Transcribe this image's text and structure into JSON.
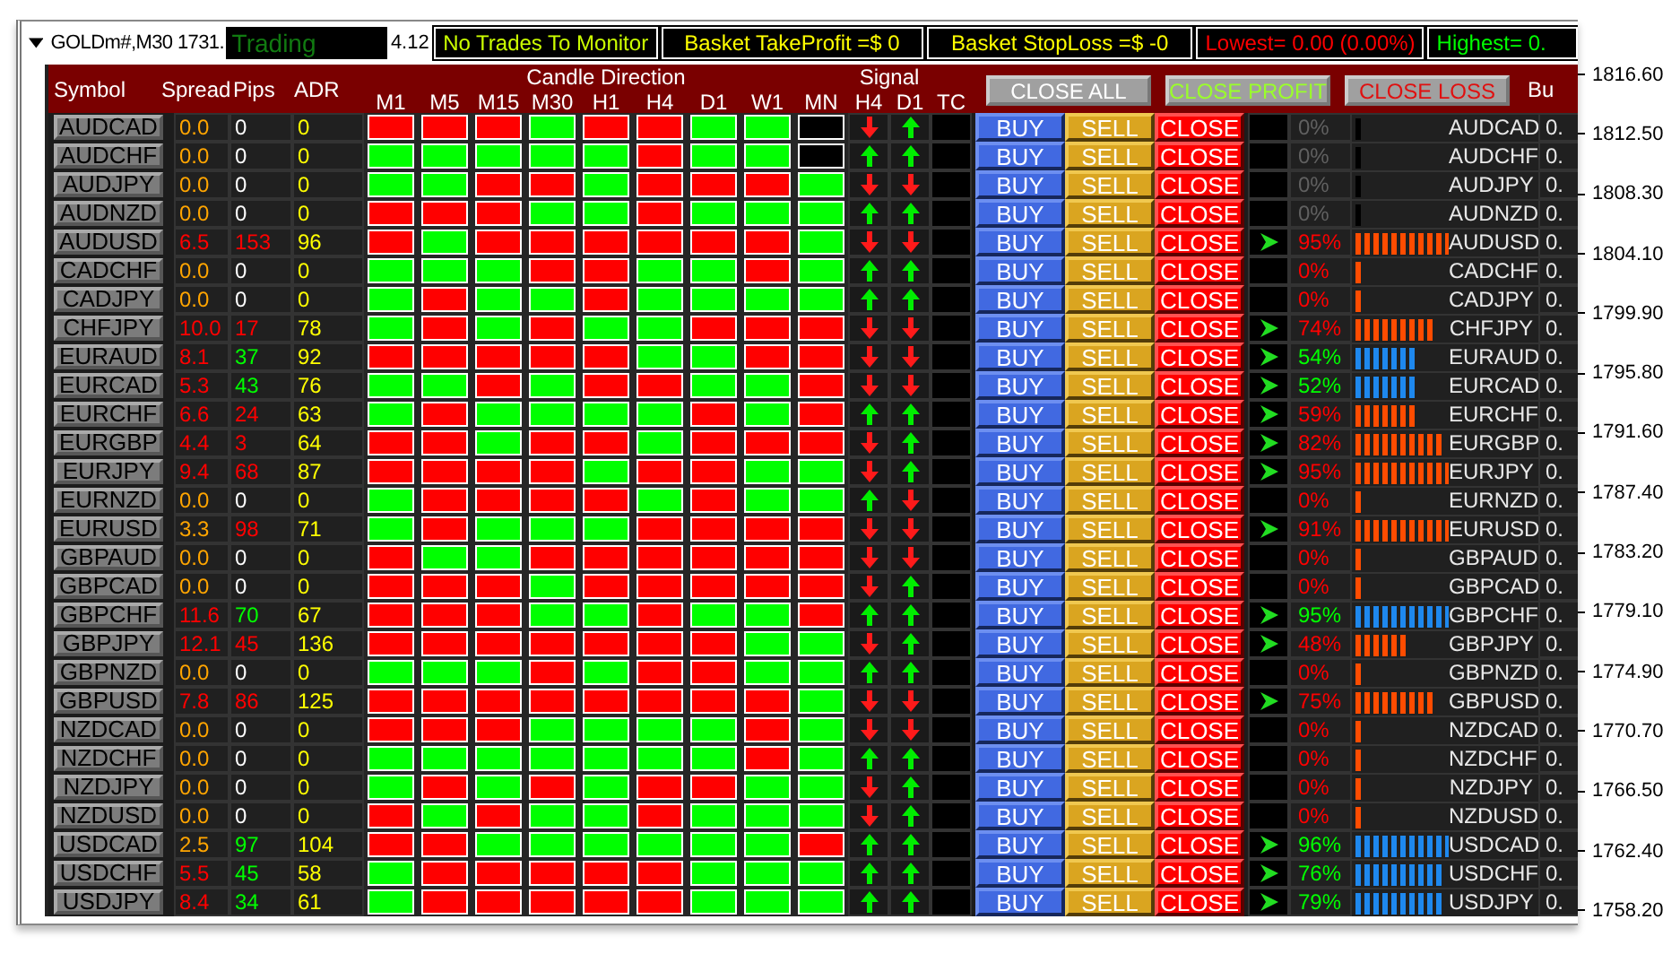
{
  "top_bar": {
    "chart_label": "GOLDm#,M30 1731.",
    "status": "Trading",
    "price_tail": "4.12",
    "panels": [
      {
        "text": "No Trades To Monitor",
        "color": "#ccff00"
      },
      {
        "text": "Basket TakeProfit =$ 0",
        "color": "#ffff00"
      },
      {
        "text": "Basket StopLoss =$ -0",
        "color": "#ffff00"
      },
      {
        "text": "Lowest= 0.00 (0.00%)",
        "color": "#ff0000"
      },
      {
        "text": "Highest= 0.",
        "color": "#00ff00"
      }
    ]
  },
  "header": {
    "symbol": "Symbol",
    "spread": "Spread",
    "pips": "Pips",
    "adr": "ADR",
    "candle_direction": "Candle Direction",
    "timeframes": [
      "M1",
      "M5",
      "M15",
      "M30",
      "H1",
      "H4",
      "D1",
      "W1",
      "MN"
    ],
    "signal": "Signal",
    "signal_columns": [
      "H4",
      "D1"
    ],
    "tc": "TC",
    "buttons": [
      {
        "label": "CLOSE ALL",
        "kind": "all"
      },
      {
        "label": "CLOSE PROFIT",
        "kind": "profit"
      },
      {
        "label": "CLOSE LOSS",
        "kind": "loss"
      }
    ],
    "column_tail": "Bu"
  },
  "rows": [
    {
      "symbol": "AUDCAD",
      "spread": {
        "text": "0.0",
        "color": "#ffa500"
      },
      "pips": {
        "text": "0",
        "color": "#ffffff"
      },
      "adr": "0",
      "candles": [
        {
          "color": "#ff0000"
        },
        {
          "color": "#ff0000"
        },
        {
          "color": "#ff0000"
        },
        {
          "color": "#00ff00"
        },
        {
          "color": "#ff0000"
        },
        {
          "color": "#ff0000"
        },
        {
          "color": "#00ff00"
        },
        {
          "color": "#00ff00"
        },
        {
          "color": "#000000"
        }
      ],
      "h4_up": false,
      "d1_up": true,
      "buy": "BUY",
      "sell": "SELL",
      "close": "CLOSE",
      "trend_arrow": false,
      "strength": {
        "text": "0%",
        "color": "#606060"
      },
      "meter": {
        "color": "#000000"
      },
      "pair": "AUDCAD",
      "value": "0."
    },
    {
      "symbol": "AUDCHF",
      "spread": {
        "text": "0.0",
        "color": "#ffa500"
      },
      "pips": {
        "text": "0",
        "color": "#ffffff"
      },
      "adr": "0",
      "candles": [
        {
          "color": "#00ff00"
        },
        {
          "color": "#00ff00"
        },
        {
          "color": "#00ff00"
        },
        {
          "color": "#00ff00"
        },
        {
          "color": "#00ff00"
        },
        {
          "color": "#ff0000"
        },
        {
          "color": "#00ff00"
        },
        {
          "color": "#00ff00"
        },
        {
          "color": "#000000"
        }
      ],
      "h4_up": true,
      "d1_up": true,
      "buy": "BUY",
      "sell": "SELL",
      "close": "CLOSE",
      "trend_arrow": false,
      "strength": {
        "text": "0%",
        "color": "#606060"
      },
      "meter": {
        "color": "#000000"
      },
      "pair": "AUDCHF",
      "value": "0."
    },
    {
      "symbol": "AUDJPY",
      "spread": {
        "text": "0.0",
        "color": "#ffa500"
      },
      "pips": {
        "text": "0",
        "color": "#ffffff"
      },
      "adr": "0",
      "candles": [
        {
          "color": "#00ff00"
        },
        {
          "color": "#00ff00"
        },
        {
          "color": "#ff0000"
        },
        {
          "color": "#ff0000"
        },
        {
          "color": "#00ff00"
        },
        {
          "color": "#ff0000"
        },
        {
          "color": "#ff0000"
        },
        {
          "color": "#ff0000"
        },
        {
          "color": "#00ff00"
        }
      ],
      "h4_up": false,
      "d1_up": false,
      "buy": "BUY",
      "sell": "SELL",
      "close": "CLOSE",
      "trend_arrow": false,
      "strength": {
        "text": "0%",
        "color": "#606060"
      },
      "meter": {
        "color": "#000000"
      },
      "pair": "AUDJPY",
      "value": "0."
    },
    {
      "symbol": "AUDNZD",
      "spread": {
        "text": "0.0",
        "color": "#ffa500"
      },
      "pips": {
        "text": "0",
        "color": "#ffffff"
      },
      "adr": "0",
      "candles": [
        {
          "color": "#ff0000"
        },
        {
          "color": "#ff0000"
        },
        {
          "color": "#ff0000"
        },
        {
          "color": "#00ff00"
        },
        {
          "color": "#00ff00"
        },
        {
          "color": "#ff0000"
        },
        {
          "color": "#00ff00"
        },
        {
          "color": "#00ff00"
        },
        {
          "color": "#00ff00"
        }
      ],
      "h4_up": true,
      "d1_up": true,
      "buy": "BUY",
      "sell": "SELL",
      "close": "CLOSE",
      "trend_arrow": false,
      "strength": {
        "text": "0%",
        "color": "#606060"
      },
      "meter": {
        "color": "#000000"
      },
      "pair": "AUDNZD",
      "value": "0."
    },
    {
      "symbol": "AUDUSD",
      "spread": {
        "text": "6.5",
        "color": "#ff0000"
      },
      "pips": {
        "text": "153",
        "color": "#ff0000"
      },
      "adr": "96",
      "candles": [
        {
          "color": "#ff0000"
        },
        {
          "color": "#00ff00"
        },
        {
          "color": "#ff0000"
        },
        {
          "color": "#ff0000"
        },
        {
          "color": "#ff0000"
        },
        {
          "color": "#ff0000"
        },
        {
          "color": "#ff0000"
        },
        {
          "color": "#ff0000"
        },
        {
          "color": "#00ff00"
        }
      ],
      "h4_up": false,
      "d1_up": false,
      "buy": "BUY",
      "sell": "SELL",
      "close": "CLOSE",
      "trend_arrow": true,
      "strength": {
        "text": "95%",
        "color": "#ff0000"
      },
      "meter": {
        "color": "#ff4c00"
      },
      "pair": "AUDUSD",
      "value": "0."
    },
    {
      "symbol": "CADCHF",
      "spread": {
        "text": "0.0",
        "color": "#ffa500"
      },
      "pips": {
        "text": "0",
        "color": "#ffffff"
      },
      "adr": "0",
      "candles": [
        {
          "color": "#00ff00"
        },
        {
          "color": "#00ff00"
        },
        {
          "color": "#00ff00"
        },
        {
          "color": "#ff0000"
        },
        {
          "color": "#ff0000"
        },
        {
          "color": "#00ff00"
        },
        {
          "color": "#00ff00"
        },
        {
          "color": "#ff0000"
        },
        {
          "color": "#00ff00"
        }
      ],
      "h4_up": true,
      "d1_up": true,
      "buy": "BUY",
      "sell": "SELL",
      "close": "CLOSE",
      "trend_arrow": false,
      "strength": {
        "text": "0%",
        "color": "#ff0000"
      },
      "meter": {
        "color": "#ff4c00"
      },
      "pair": "CADCHF",
      "value": "0."
    },
    {
      "symbol": "CADJPY",
      "spread": {
        "text": "0.0",
        "color": "#ffa500"
      },
      "pips": {
        "text": "0",
        "color": "#ffffff"
      },
      "adr": "0",
      "candles": [
        {
          "color": "#00ff00"
        },
        {
          "color": "#ff0000"
        },
        {
          "color": "#00ff00"
        },
        {
          "color": "#00ff00"
        },
        {
          "color": "#ff0000"
        },
        {
          "color": "#00ff00"
        },
        {
          "color": "#00ff00"
        },
        {
          "color": "#00ff00"
        },
        {
          "color": "#00ff00"
        }
      ],
      "h4_up": true,
      "d1_up": true,
      "buy": "BUY",
      "sell": "SELL",
      "close": "CLOSE",
      "trend_arrow": false,
      "strength": {
        "text": "0%",
        "color": "#ff0000"
      },
      "meter": {
        "color": "#ff4c00"
      },
      "pair": "CADJPY",
      "value": "0."
    },
    {
      "symbol": "CHFJPY",
      "spread": {
        "text": "10.0",
        "color": "#ff0000"
      },
      "pips": {
        "text": "17",
        "color": "#ff0000"
      },
      "adr": "78",
      "candles": [
        {
          "color": "#00ff00"
        },
        {
          "color": "#ff0000"
        },
        {
          "color": "#00ff00"
        },
        {
          "color": "#ff0000"
        },
        {
          "color": "#00ff00"
        },
        {
          "color": "#00ff00"
        },
        {
          "color": "#ff0000"
        },
        {
          "color": "#ff0000"
        },
        {
          "color": "#ff0000"
        }
      ],
      "h4_up": false,
      "d1_up": false,
      "buy": "BUY",
      "sell": "SELL",
      "close": "CLOSE",
      "trend_arrow": true,
      "strength": {
        "text": "74%",
        "color": "#ff0000"
      },
      "meter": {
        "color": "#ff4c00"
      },
      "pair": "CHFJPY",
      "value": "0."
    },
    {
      "symbol": "EURAUD",
      "spread": {
        "text": "8.1",
        "color": "#ff0000"
      },
      "pips": {
        "text": "37",
        "color": "#00ff00"
      },
      "adr": "92",
      "candles": [
        {
          "color": "#ff0000"
        },
        {
          "color": "#ff0000"
        },
        {
          "color": "#ff0000"
        },
        {
          "color": "#ff0000"
        },
        {
          "color": "#ff0000"
        },
        {
          "color": "#00ff00"
        },
        {
          "color": "#00ff00"
        },
        {
          "color": "#ff0000"
        },
        {
          "color": "#ff0000"
        }
      ],
      "h4_up": false,
      "d1_up": false,
      "buy": "BUY",
      "sell": "SELL",
      "close": "CLOSE",
      "trend_arrow": true,
      "strength": {
        "text": "54%",
        "color": "#00ff00"
      },
      "meter": {
        "color": "#1e88ee"
      },
      "pair": "EURAUD",
      "value": "0."
    },
    {
      "symbol": "EURCAD",
      "spread": {
        "text": "5.3",
        "color": "#ff0000"
      },
      "pips": {
        "text": "43",
        "color": "#00ff00"
      },
      "adr": "76",
      "candles": [
        {
          "color": "#00ff00"
        },
        {
          "color": "#00ff00"
        },
        {
          "color": "#ff0000"
        },
        {
          "color": "#00ff00"
        },
        {
          "color": "#ff0000"
        },
        {
          "color": "#ff0000"
        },
        {
          "color": "#00ff00"
        },
        {
          "color": "#00ff00"
        },
        {
          "color": "#ff0000"
        }
      ],
      "h4_up": false,
      "d1_up": false,
      "buy": "BUY",
      "sell": "SELL",
      "close": "CLOSE",
      "trend_arrow": true,
      "strength": {
        "text": "52%",
        "color": "#00ff00"
      },
      "meter": {
        "color": "#1e88ee"
      },
      "pair": "EURCAD",
      "value": "0."
    },
    {
      "symbol": "EURCHF",
      "spread": {
        "text": "6.6",
        "color": "#ff0000"
      },
      "pips": {
        "text": "24",
        "color": "#ff0000"
      },
      "adr": "63",
      "candles": [
        {
          "color": "#00ff00"
        },
        {
          "color": "#ff0000"
        },
        {
          "color": "#00ff00"
        },
        {
          "color": "#00ff00"
        },
        {
          "color": "#00ff00"
        },
        {
          "color": "#00ff00"
        },
        {
          "color": "#ff0000"
        },
        {
          "color": "#00ff00"
        },
        {
          "color": "#ff0000"
        }
      ],
      "h4_up": true,
      "d1_up": true,
      "buy": "BUY",
      "sell": "SELL",
      "close": "CLOSE",
      "trend_arrow": true,
      "strength": {
        "text": "59%",
        "color": "#ff0000"
      },
      "meter": {
        "color": "#ff4c00"
      },
      "pair": "EURCHF",
      "value": "0."
    },
    {
      "symbol": "EURGBP",
      "spread": {
        "text": "4.4",
        "color": "#ff0000"
      },
      "pips": {
        "text": "3",
        "color": "#ff0000"
      },
      "adr": "64",
      "candles": [
        {
          "color": "#ff0000"
        },
        {
          "color": "#ff0000"
        },
        {
          "color": "#00ff00"
        },
        {
          "color": "#ff0000"
        },
        {
          "color": "#ff0000"
        },
        {
          "color": "#00ff00"
        },
        {
          "color": "#ff0000"
        },
        {
          "color": "#ff0000"
        },
        {
          "color": "#ff0000"
        }
      ],
      "h4_up": false,
      "d1_up": true,
      "buy": "BUY",
      "sell": "SELL",
      "close": "CLOSE",
      "trend_arrow": true,
      "strength": {
        "text": "82%",
        "color": "#ff0000"
      },
      "meter": {
        "color": "#ff4c00"
      },
      "pair": "EURGBP",
      "value": "0."
    },
    {
      "symbol": "EURJPY",
      "spread": {
        "text": "9.4",
        "color": "#ff0000"
      },
      "pips": {
        "text": "68",
        "color": "#ff0000"
      },
      "adr": "87",
      "candles": [
        {
          "color": "#ff0000"
        },
        {
          "color": "#ff0000"
        },
        {
          "color": "#ff0000"
        },
        {
          "color": "#ff0000"
        },
        {
          "color": "#00ff00"
        },
        {
          "color": "#ff0000"
        },
        {
          "color": "#ff0000"
        },
        {
          "color": "#00ff00"
        },
        {
          "color": "#00ff00"
        }
      ],
      "h4_up": false,
      "d1_up": true,
      "buy": "BUY",
      "sell": "SELL",
      "close": "CLOSE",
      "trend_arrow": true,
      "strength": {
        "text": "95%",
        "color": "#ff0000"
      },
      "meter": {
        "color": "#ff4c00"
      },
      "pair": "EURJPY",
      "value": "0."
    },
    {
      "symbol": "EURNZD",
      "spread": {
        "text": "0.0",
        "color": "#ffa500"
      },
      "pips": {
        "text": "0",
        "color": "#ffffff"
      },
      "adr": "0",
      "candles": [
        {
          "color": "#00ff00"
        },
        {
          "color": "#ff0000"
        },
        {
          "color": "#ff0000"
        },
        {
          "color": "#ff0000"
        },
        {
          "color": "#ff0000"
        },
        {
          "color": "#00ff00"
        },
        {
          "color": "#ff0000"
        },
        {
          "color": "#00ff00"
        },
        {
          "color": "#00ff00"
        }
      ],
      "h4_up": true,
      "d1_up": false,
      "buy": "BUY",
      "sell": "SELL",
      "close": "CLOSE",
      "trend_arrow": false,
      "strength": {
        "text": "0%",
        "color": "#ff0000"
      },
      "meter": {
        "color": "#ff4c00"
      },
      "pair": "EURNZD",
      "value": "0."
    },
    {
      "symbol": "EURUSD",
      "spread": {
        "text": "3.3",
        "color": "#ffa500"
      },
      "pips": {
        "text": "98",
        "color": "#ff0000"
      },
      "adr": "71",
      "candles": [
        {
          "color": "#00ff00"
        },
        {
          "color": "#ff0000"
        },
        {
          "color": "#00ff00"
        },
        {
          "color": "#00ff00"
        },
        {
          "color": "#00ff00"
        },
        {
          "color": "#ff0000"
        },
        {
          "color": "#ff0000"
        },
        {
          "color": "#ff0000"
        },
        {
          "color": "#ff0000"
        }
      ],
      "h4_up": false,
      "d1_up": false,
      "buy": "BUY",
      "sell": "SELL",
      "close": "CLOSE",
      "trend_arrow": true,
      "strength": {
        "text": "91%",
        "color": "#ff0000"
      },
      "meter": {
        "color": "#ff4c00"
      },
      "pair": "EURUSD",
      "value": "0."
    },
    {
      "symbol": "GBPAUD",
      "spread": {
        "text": "0.0",
        "color": "#ffa500"
      },
      "pips": {
        "text": "0",
        "color": "#ffffff"
      },
      "adr": "0",
      "candles": [
        {
          "color": "#ff0000"
        },
        {
          "color": "#00ff00"
        },
        {
          "color": "#00ff00"
        },
        {
          "color": "#ff0000"
        },
        {
          "color": "#ff0000"
        },
        {
          "color": "#ff0000"
        },
        {
          "color": "#ff0000"
        },
        {
          "color": "#ff0000"
        },
        {
          "color": "#ff0000"
        }
      ],
      "h4_up": false,
      "d1_up": false,
      "buy": "BUY",
      "sell": "SELL",
      "close": "CLOSE",
      "trend_arrow": false,
      "strength": {
        "text": "0%",
        "color": "#ff0000"
      },
      "meter": {
        "color": "#ff4c00"
      },
      "pair": "GBPAUD",
      "value": "0."
    },
    {
      "symbol": "GBPCAD",
      "spread": {
        "text": "0.0",
        "color": "#ffa500"
      },
      "pips": {
        "text": "0",
        "color": "#ffffff"
      },
      "adr": "0",
      "candles": [
        {
          "color": "#ff0000"
        },
        {
          "color": "#ff0000"
        },
        {
          "color": "#ff0000"
        },
        {
          "color": "#00ff00"
        },
        {
          "color": "#ff0000"
        },
        {
          "color": "#ff0000"
        },
        {
          "color": "#ff0000"
        },
        {
          "color": "#ff0000"
        },
        {
          "color": "#ff0000"
        }
      ],
      "h4_up": false,
      "d1_up": true,
      "buy": "BUY",
      "sell": "SELL",
      "close": "CLOSE",
      "trend_arrow": false,
      "strength": {
        "text": "0%",
        "color": "#ff0000"
      },
      "meter": {
        "color": "#ff4c00"
      },
      "pair": "GBPCAD",
      "value": "0."
    },
    {
      "symbol": "GBPCHF",
      "spread": {
        "text": "11.6",
        "color": "#ff0000"
      },
      "pips": {
        "text": "70",
        "color": "#00ff00"
      },
      "adr": "67",
      "candles": [
        {
          "color": "#ff0000"
        },
        {
          "color": "#ff0000"
        },
        {
          "color": "#ff0000"
        },
        {
          "color": "#00ff00"
        },
        {
          "color": "#00ff00"
        },
        {
          "color": "#ff0000"
        },
        {
          "color": "#00ff00"
        },
        {
          "color": "#00ff00"
        },
        {
          "color": "#ff0000"
        }
      ],
      "h4_up": true,
      "d1_up": true,
      "buy": "BUY",
      "sell": "SELL",
      "close": "CLOSE",
      "trend_arrow": true,
      "strength": {
        "text": "95%",
        "color": "#00ff00"
      },
      "meter": {
        "color": "#1e88ee"
      },
      "pair": "GBPCHF",
      "value": "0."
    },
    {
      "symbol": "GBPJPY",
      "spread": {
        "text": "12.1",
        "color": "#ff0000"
      },
      "pips": {
        "text": "45",
        "color": "#ff0000"
      },
      "adr": "136",
      "candles": [
        {
          "color": "#ff0000"
        },
        {
          "color": "#ff0000"
        },
        {
          "color": "#ff0000"
        },
        {
          "color": "#ff0000"
        },
        {
          "color": "#ff0000"
        },
        {
          "color": "#ff0000"
        },
        {
          "color": "#ff0000"
        },
        {
          "color": "#00ff00"
        },
        {
          "color": "#00ff00"
        }
      ],
      "h4_up": false,
      "d1_up": true,
      "buy": "BUY",
      "sell": "SELL",
      "close": "CLOSE",
      "trend_arrow": true,
      "strength": {
        "text": "48%",
        "color": "#ff0000"
      },
      "meter": {
        "color": "#ff4c00"
      },
      "pair": "GBPJPY",
      "value": "0."
    },
    {
      "symbol": "GBPNZD",
      "spread": {
        "text": "0.0",
        "color": "#ffa500"
      },
      "pips": {
        "text": "0",
        "color": "#ffffff"
      },
      "adr": "0",
      "candles": [
        {
          "color": "#00ff00"
        },
        {
          "color": "#00ff00"
        },
        {
          "color": "#00ff00"
        },
        {
          "color": "#ff0000"
        },
        {
          "color": "#00ff00"
        },
        {
          "color": "#ff0000"
        },
        {
          "color": "#ff0000"
        },
        {
          "color": "#00ff00"
        },
        {
          "color": "#00ff00"
        }
      ],
      "h4_up": true,
      "d1_up": true,
      "buy": "BUY",
      "sell": "SELL",
      "close": "CLOSE",
      "trend_arrow": false,
      "strength": {
        "text": "0%",
        "color": "#ff0000"
      },
      "meter": {
        "color": "#ff4c00"
      },
      "pair": "GBPNZD",
      "value": "0."
    },
    {
      "symbol": "GBPUSD",
      "spread": {
        "text": "7.8",
        "color": "#ff0000"
      },
      "pips": {
        "text": "86",
        "color": "#ff0000"
      },
      "adr": "125",
      "candles": [
        {
          "color": "#ff0000"
        },
        {
          "color": "#ff0000"
        },
        {
          "color": "#ff0000"
        },
        {
          "color": "#ff0000"
        },
        {
          "color": "#ff0000"
        },
        {
          "color": "#ff0000"
        },
        {
          "color": "#ff0000"
        },
        {
          "color": "#ff0000"
        },
        {
          "color": "#00ff00"
        }
      ],
      "h4_up": false,
      "d1_up": false,
      "buy": "BUY",
      "sell": "SELL",
      "close": "CLOSE",
      "trend_arrow": true,
      "strength": {
        "text": "75%",
        "color": "#ff0000"
      },
      "meter": {
        "color": "#ff4c00"
      },
      "pair": "GBPUSD",
      "value": "0."
    },
    {
      "symbol": "NZDCAD",
      "spread": {
        "text": "0.0",
        "color": "#ffa500"
      },
      "pips": {
        "text": "0",
        "color": "#ffffff"
      },
      "adr": "0",
      "candles": [
        {
          "color": "#ff0000"
        },
        {
          "color": "#ff0000"
        },
        {
          "color": "#ff0000"
        },
        {
          "color": "#00ff00"
        },
        {
          "color": "#00ff00"
        },
        {
          "color": "#00ff00"
        },
        {
          "color": "#00ff00"
        },
        {
          "color": "#ff0000"
        },
        {
          "color": "#00ff00"
        }
      ],
      "h4_up": false,
      "d1_up": false,
      "buy": "BUY",
      "sell": "SELL",
      "close": "CLOSE",
      "trend_arrow": false,
      "strength": {
        "text": "0%",
        "color": "#ff0000"
      },
      "meter": {
        "color": "#ff4c00"
      },
      "pair": "NZDCAD",
      "value": "0."
    },
    {
      "symbol": "NZDCHF",
      "spread": {
        "text": "0.0",
        "color": "#ffa500"
      },
      "pips": {
        "text": "0",
        "color": "#ffffff"
      },
      "adr": "0",
      "candles": [
        {
          "color": "#00ff00"
        },
        {
          "color": "#00ff00"
        },
        {
          "color": "#00ff00"
        },
        {
          "color": "#00ff00"
        },
        {
          "color": "#00ff00"
        },
        {
          "color": "#00ff00"
        },
        {
          "color": "#00ff00"
        },
        {
          "color": "#ff0000"
        },
        {
          "color": "#00ff00"
        }
      ],
      "h4_up": true,
      "d1_up": true,
      "buy": "BUY",
      "sell": "SELL",
      "close": "CLOSE",
      "trend_arrow": false,
      "strength": {
        "text": "0%",
        "color": "#ff0000"
      },
      "meter": {
        "color": "#ff4c00"
      },
      "pair": "NZDCHF",
      "value": "0."
    },
    {
      "symbol": "NZDJPY",
      "spread": {
        "text": "0.0",
        "color": "#ffa500"
      },
      "pips": {
        "text": "0",
        "color": "#ffffff"
      },
      "adr": "0",
      "candles": [
        {
          "color": "#00ff00"
        },
        {
          "color": "#ff0000"
        },
        {
          "color": "#00ff00"
        },
        {
          "color": "#ff0000"
        },
        {
          "color": "#00ff00"
        },
        {
          "color": "#ff0000"
        },
        {
          "color": "#ff0000"
        },
        {
          "color": "#00ff00"
        },
        {
          "color": "#00ff00"
        }
      ],
      "h4_up": false,
      "d1_up": true,
      "buy": "BUY",
      "sell": "SELL",
      "close": "CLOSE",
      "trend_arrow": false,
      "strength": {
        "text": "0%",
        "color": "#ff0000"
      },
      "meter": {
        "color": "#ff4c00"
      },
      "pair": "NZDJPY",
      "value": "0."
    },
    {
      "symbol": "NZDUSD",
      "spread": {
        "text": "0.0",
        "color": "#ffa500"
      },
      "pips": {
        "text": "0",
        "color": "#ffffff"
      },
      "adr": "0",
      "candles": [
        {
          "color": "#ff0000"
        },
        {
          "color": "#00ff00"
        },
        {
          "color": "#ff0000"
        },
        {
          "color": "#00ff00"
        },
        {
          "color": "#00ff00"
        },
        {
          "color": "#ff0000"
        },
        {
          "color": "#00ff00"
        },
        {
          "color": "#00ff00"
        },
        {
          "color": "#00ff00"
        }
      ],
      "h4_up": false,
      "d1_up": true,
      "buy": "BUY",
      "sell": "SELL",
      "close": "CLOSE",
      "trend_arrow": false,
      "strength": {
        "text": "0%",
        "color": "#ff0000"
      },
      "meter": {
        "color": "#ff4c00"
      },
      "pair": "NZDUSD",
      "value": "0."
    },
    {
      "symbol": "USDCAD",
      "spread": {
        "text": "2.5",
        "color": "#ffa500"
      },
      "pips": {
        "text": "97",
        "color": "#00ff00"
      },
      "adr": "104",
      "candles": [
        {
          "color": "#ff0000"
        },
        {
          "color": "#ff0000"
        },
        {
          "color": "#00ff00"
        },
        {
          "color": "#00ff00"
        },
        {
          "color": "#00ff00"
        },
        {
          "color": "#00ff00"
        },
        {
          "color": "#00ff00"
        },
        {
          "color": "#00ff00"
        },
        {
          "color": "#ff0000"
        }
      ],
      "h4_up": true,
      "d1_up": true,
      "buy": "BUY",
      "sell": "SELL",
      "close": "CLOSE",
      "trend_arrow": true,
      "strength": {
        "text": "96%",
        "color": "#00ff00"
      },
      "meter": {
        "color": "#1e88ee"
      },
      "pair": "USDCAD",
      "value": "0."
    },
    {
      "symbol": "USDCHF",
      "spread": {
        "text": "5.5",
        "color": "#ff0000"
      },
      "pips": {
        "text": "45",
        "color": "#00ff00"
      },
      "adr": "58",
      "candles": [
        {
          "color": "#00ff00"
        },
        {
          "color": "#ff0000"
        },
        {
          "color": "#ff0000"
        },
        {
          "color": "#ff0000"
        },
        {
          "color": "#ff0000"
        },
        {
          "color": "#ff0000"
        },
        {
          "color": "#00ff00"
        },
        {
          "color": "#00ff00"
        },
        {
          "color": "#00ff00"
        }
      ],
      "h4_up": true,
      "d1_up": true,
      "buy": "BUY",
      "sell": "SELL",
      "close": "CLOSE",
      "trend_arrow": true,
      "strength": {
        "text": "76%",
        "color": "#00ff00"
      },
      "meter": {
        "color": "#1e88ee"
      },
      "pair": "USDCHF",
      "value": "0."
    },
    {
      "symbol": "USDJPY",
      "spread": {
        "text": "8.4",
        "color": "#ff0000"
      },
      "pips": {
        "text": "34",
        "color": "#00ff00"
      },
      "adr": "61",
      "candles": [
        {
          "color": "#00ff00"
        },
        {
          "color": "#ff0000"
        },
        {
          "color": "#ff0000"
        },
        {
          "color": "#ff0000"
        },
        {
          "color": "#ff0000"
        },
        {
          "color": "#ff0000"
        },
        {
          "color": "#00ff00"
        },
        {
          "color": "#00ff00"
        },
        {
          "color": "#00ff00"
        }
      ],
      "h4_up": true,
      "d1_up": true,
      "buy": "BUY",
      "sell": "SELL",
      "close": "CLOSE",
      "trend_arrow": true,
      "strength": {
        "text": "79%",
        "color": "#00ff00"
      },
      "meter": {
        "color": "#1e88ee"
      },
      "pair": "USDJPY",
      "value": "0."
    }
  ],
  "price_axis": [
    "1816.60",
    "1812.50",
    "1808.30",
    "1804.10",
    "1799.90",
    "1795.80",
    "1791.60",
    "1787.40",
    "1783.20",
    "1779.10",
    "1774.90",
    "1770.70",
    "1766.50",
    "1762.40",
    "1758.20"
  ]
}
